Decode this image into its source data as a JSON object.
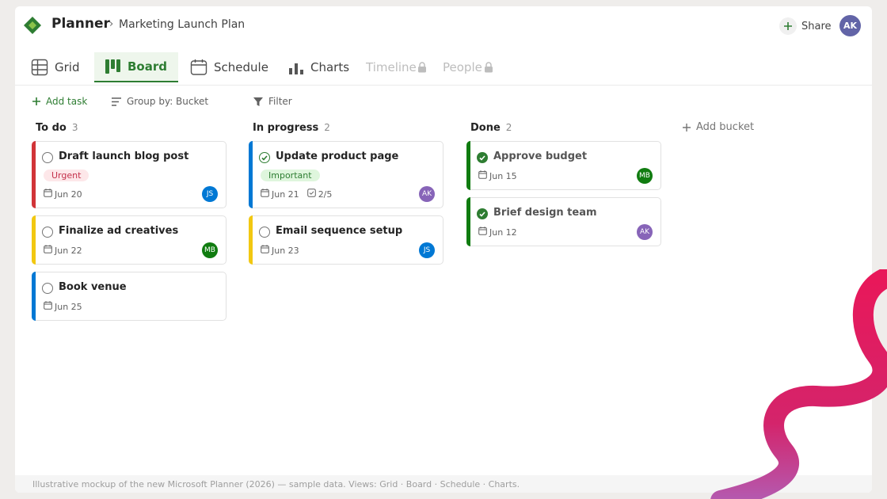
{
  "header": {
    "app_name": "Planner",
    "crumb_sep": "›",
    "plan_name": "Marketing Launch Plan",
    "share_label": "Share",
    "user_initials": "AK",
    "brand_color": "#2e7d32"
  },
  "tabs": [
    {
      "label": "Grid",
      "icon": "grid-icon",
      "active": false,
      "locked": false
    },
    {
      "label": "Board",
      "icon": "board-icon",
      "active": true,
      "locked": false
    },
    {
      "label": "Schedule",
      "icon": "calendar-icon",
      "active": false,
      "locked": false
    },
    {
      "label": "Charts",
      "icon": "bar-chart-icon",
      "active": false,
      "locked": false
    },
    {
      "label": "Timeline",
      "icon": "lock-icon",
      "active": false,
      "locked": true
    },
    {
      "label": "People",
      "icon": "lock-icon",
      "active": false,
      "locked": true
    }
  ],
  "toolbar": {
    "add_task": "Add task",
    "group_by": "Group by: Bucket",
    "filter": "Filter"
  },
  "buckets": [
    {
      "title": "To do",
      "count": "3",
      "tasks": [
        {
          "title": "Draft launch blog post",
          "label": "Urgent",
          "due": "Jun 20",
          "assignee": "JS",
          "bar": "#d13438"
        },
        {
          "title": "Finalize ad creatives",
          "due": "Jun 22",
          "assignee": "MB",
          "bar": "#f2c811"
        },
        {
          "title": "Book venue",
          "due": "Jun 25",
          "bar": "#0078d4"
        }
      ]
    },
    {
      "title": "In progress",
      "count": "2",
      "tasks": [
        {
          "title": "Update product page",
          "label": "Important",
          "due": "Jun 21",
          "checklist": "2/5",
          "assignee": "AK",
          "bar": "#0078d4"
        },
        {
          "title": "Email sequence setup",
          "due": "Jun 23",
          "assignee": "JS",
          "bar": "#f2c811"
        }
      ]
    },
    {
      "title": "Done",
      "count": "2",
      "tasks": [
        {
          "title": "Approve budget",
          "due": "Jun 15",
          "assignee": "MB",
          "bar": "#107c10"
        },
        {
          "title": "Brief design team",
          "due": "Jun 12",
          "assignee": "AK",
          "bar": "#107c10"
        }
      ]
    }
  ],
  "add_bucket": "Add bucket",
  "avatar_colors": {
    "JS": "#0078d4",
    "MB": "#107c10",
    "AK": "#8764b8"
  },
  "footer": "Illustrative mockup of the new Microsoft Planner (2026) — sample data. Views: Grid · Board · Schedule · Charts."
}
